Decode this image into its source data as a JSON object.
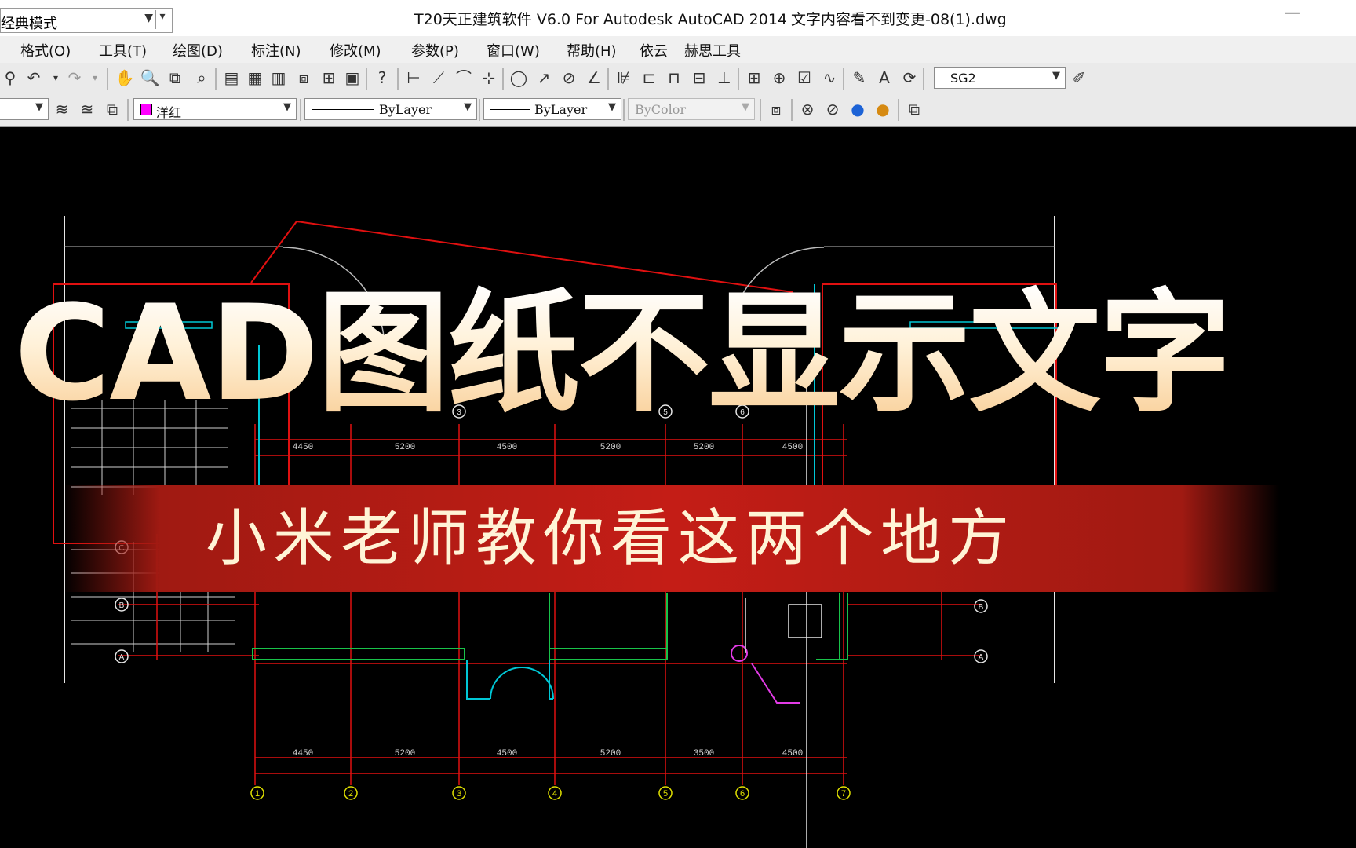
{
  "titlebar": {
    "workspace": "经典模式",
    "app_title": "T20天正建筑软件 V6.0 For Autodesk AutoCAD 2014",
    "file_title": "文字内容看不到变更-08(1).dwg",
    "minimize": "—"
  },
  "menu": {
    "items": [
      "格式(O)",
      "工具(T)",
      "绘图(D)",
      "标注(N)",
      "修改(M)",
      "参数(P)",
      "窗口(W)",
      "帮助(H)",
      "依云",
      "赫思工具"
    ]
  },
  "toolbar2": {
    "layer_color_value": "洋红",
    "linetype_value": "ByLayer",
    "lineweight_value": "ByLayer",
    "plotstyle_value": "ByColor"
  },
  "toolbar1": {
    "dimstyle_value": "SG2"
  },
  "drawing": {
    "dimensions_top": [
      "4450",
      "5200",
      "4500",
      "5200",
      "5200",
      "4500"
    ],
    "dimensions_bottom": [
      "4450",
      "5200",
      "4500",
      "5200",
      "3500",
      "4500"
    ],
    "axes_bottom": [
      "1",
      "2",
      "3",
      "4",
      "5",
      "6",
      "7"
    ],
    "axes_left": [
      "C",
      "B",
      "A"
    ],
    "axes_right": [
      "B",
      "A"
    ],
    "axes_top": [
      "3",
      "5",
      "6"
    ]
  },
  "overlay": {
    "main_title": "CAD图纸不显示文字",
    "subtitle": "小米老师教你看这两个地方"
  },
  "colors": {
    "canvas": "#000000",
    "red_line": "#e01010",
    "green_line": "#19c34a",
    "cyan_line": "#00c8d6",
    "white_line": "#e6e6e6",
    "layer_swatch": "#ff00ff",
    "banner_red": "#c41d16"
  }
}
